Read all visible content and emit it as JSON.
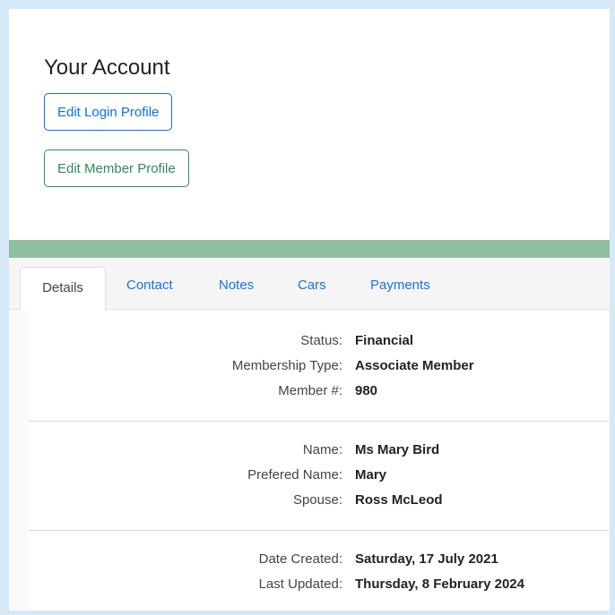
{
  "account": {
    "title": "Your Account",
    "edit_login_label": "Edit Login Profile",
    "edit_member_label": "Edit Member Profile"
  },
  "tabs": [
    {
      "label": "Details",
      "active": true
    },
    {
      "label": "Contact",
      "active": false
    },
    {
      "label": "Notes",
      "active": false
    },
    {
      "label": "Cars",
      "active": false
    },
    {
      "label": "Payments",
      "active": false
    }
  ],
  "details": {
    "membership": [
      {
        "label": "Status:",
        "value": "Financial"
      },
      {
        "label": "Membership Type:",
        "value": "Associate Member"
      },
      {
        "label": "Member #:",
        "value": "980"
      }
    ],
    "person": [
      {
        "label": "Name:",
        "value": "Ms Mary Bird"
      },
      {
        "label": "Prefered Name:",
        "value": "Mary"
      },
      {
        "label": "Spouse:",
        "value": "Ross McLeod"
      }
    ],
    "dates": [
      {
        "label": "Date Created:",
        "value": "Saturday, 17 July 2021"
      },
      {
        "label": "Last Updated:",
        "value": "Thursday, 8 February 2024"
      }
    ]
  },
  "colors": {
    "primary": "#0d6efd",
    "success": "#2e8b57",
    "band": "#8fbfa1",
    "frame_bg": "#d6e9f7"
  }
}
